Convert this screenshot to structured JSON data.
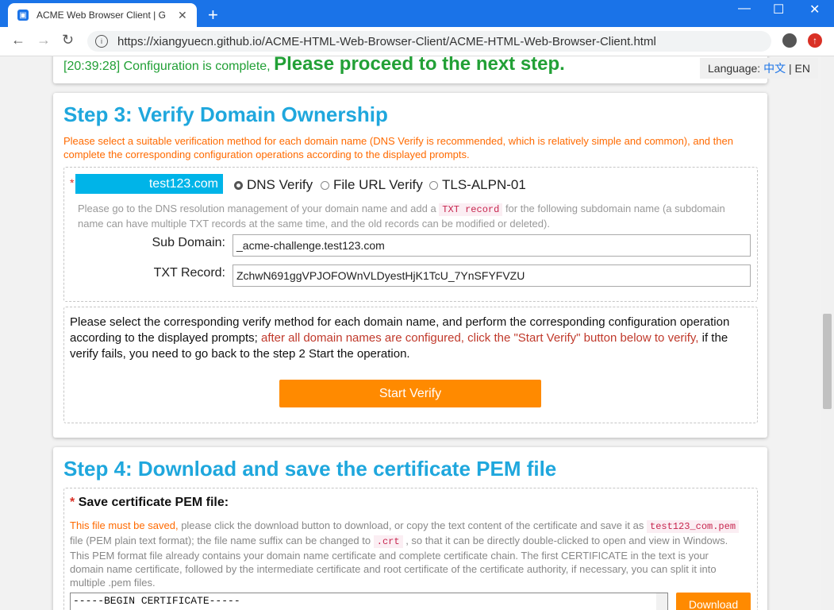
{
  "browser": {
    "tab_title": "ACME Web Browser Client | G",
    "tab_close": "✕",
    "new_tab": "+",
    "url": "https://xiangyuecn.github.io/ACME-HTML-Web-Browser-Client/ACME-HTML-Web-Browser-Client.html",
    "minimize": "—",
    "maximize": "☐",
    "close": "✕",
    "back": "←",
    "forward": "→",
    "reload": "↻"
  },
  "status": {
    "timestamp": "[20:39:28]",
    "message": "Configuration is complete,",
    "emphasis": "Please proceed to the next step."
  },
  "language": {
    "label": "Language:",
    "zh": "中文",
    "sep": "|",
    "en": "EN"
  },
  "step3": {
    "title": "Step 3: Verify Domain Ownership",
    "instruction": "Please select a suitable verification method for each domain name (DNS Verify is recommended, which is relatively simple and common), and then complete the corresponding configuration operations according to the displayed prompts.",
    "required_mark": "*",
    "domain": "test123.com",
    "options": [
      "DNS Verify",
      "File URL Verify",
      "TLS-ALPN-01"
    ],
    "hint_before": "Please go to the DNS resolution management of your domain name and add a",
    "hint_tag": "TXT record",
    "hint_after": "for the following subdomain name (a subdomain name can have multiple TXT records at the same time, and the old records can be modified or deleted).",
    "sub_domain_label": "Sub Domain:",
    "sub_domain_value": "_acme-challenge.test123.com",
    "txt_record_label": "TXT Record:",
    "txt_record_value": "ZchwN691ggVPJOFOWnVLDyestHjK1TcU_7YnSFYFVZU",
    "info_before": "Please select the corresponding verify method for each domain name, and perform the corresponding configuration operation according to the displayed prompts;",
    "info_red": "after all domain names are configured, click the \"Start Verify\" button below to verify,",
    "info_after": "if the verify fails, you need to go back to the step 2 Start the operation.",
    "start_verify": "Start Verify"
  },
  "step4": {
    "title": "Step 4: Download and save the certificate PEM file",
    "required_mark": "*",
    "save_label": "Save certificate PEM file:",
    "must_save": "This file must be saved,",
    "text1": "please click the download button to download, or copy the text content of the certificate and save it as",
    "pem_tag": "test123_com.pem",
    "text2": "file (PEM plain text format); the file name suffix can be changed to",
    "crt_tag": ".crt",
    "text3": ", so that it can be directly double-clicked to open and view in Windows. This PEM format file already contains your domain name certificate and complete certificate chain. The first CERTIFICATE in the text is your domain name certificate, followed by the intermediate certificate and root certificate of the certificate authority, if necessary, you can split it into multiple .pem files.",
    "pem_content": "-----BEGIN CERTIFICATE-----",
    "download": "Download"
  }
}
